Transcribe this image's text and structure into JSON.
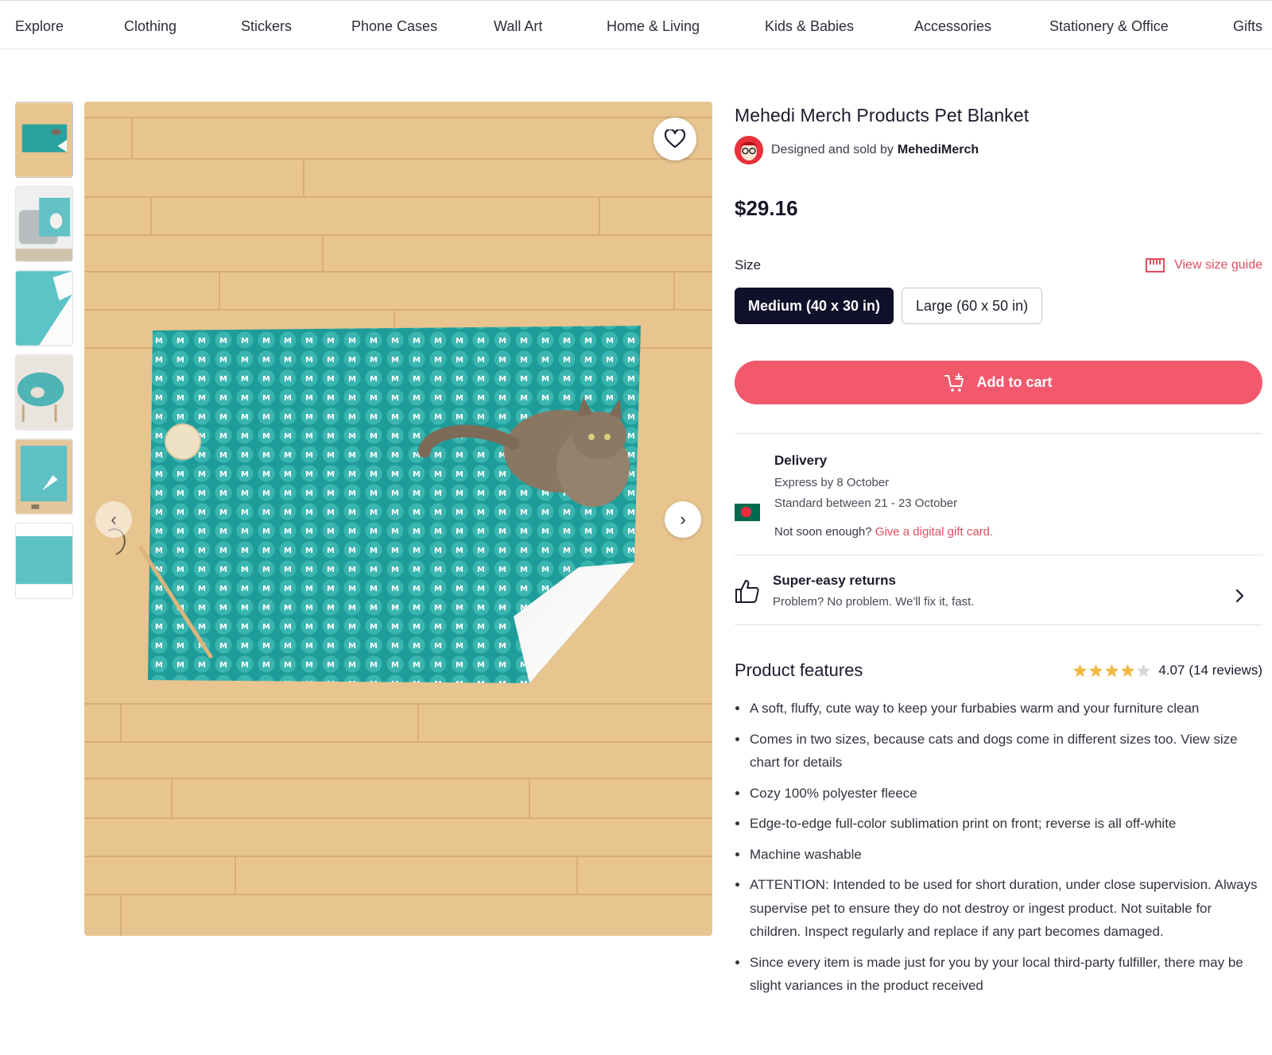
{
  "nav": {
    "items": [
      "Explore",
      "Clothing",
      "Stickers",
      "Phone Cases",
      "Wall Art",
      "Home & Living",
      "Kids & Babies",
      "Accessories",
      "Stationery & Office",
      "Gifts"
    ]
  },
  "gallery": {
    "thumbnail_count": 6,
    "main_image_alt_text": "",
    "pattern_letter": "M"
  },
  "product": {
    "title": "Mehedi Merch Products Pet Blanket",
    "designed_by_prefix": "Designed and sold by",
    "designer": "MehediMerch",
    "price": "$29.16"
  },
  "size": {
    "label": "Size",
    "guide_link": "View size guide",
    "options": [
      "Medium (40 x 30 in)",
      "Large (60 x 50 in)"
    ],
    "selected": "Medium (40 x 30 in)"
  },
  "cart": {
    "button_label": "Add to cart"
  },
  "delivery": {
    "title": "Delivery",
    "express": "Express by 8 October",
    "standard": "Standard between 21 - 23 October",
    "not_soon": "Not soon enough?",
    "gift_link": "Give a digital gift card."
  },
  "returns": {
    "title": "Super-easy returns",
    "subtitle": "Problem? No problem. We'll fix it, fast."
  },
  "features": {
    "title": "Product features",
    "rating_value": "4.07",
    "rating_count": "(14 reviews)",
    "stars_filled": 4,
    "items": [
      "A soft, fluffy, cute way to keep your furbabies warm and your furniture clean",
      "Comes in two sizes, because cats and dogs come in different sizes too. View size chart for details",
      "Cozy 100% polyester fleece",
      "Edge-to-edge full-color sublimation print on front; reverse is all off-white",
      "Machine washable",
      "ATTENTION: Intended to be used for short duration, under close supervision. Always supervise pet to ensure they do not destroy or ingest product. Not suitable for children. Inspect regularly and replace if any part becomes damaged.",
      "Since every item is made just for you by your local third-party fulfiller, there may be slight variances in the product received"
    ]
  },
  "colors": {
    "accent": "#f2596d",
    "link": "#e04d5f",
    "dark_button": "#10102a",
    "blanket_teal": "#1e9c9a",
    "wood": "#e8c48f",
    "star": "#f5b942"
  }
}
